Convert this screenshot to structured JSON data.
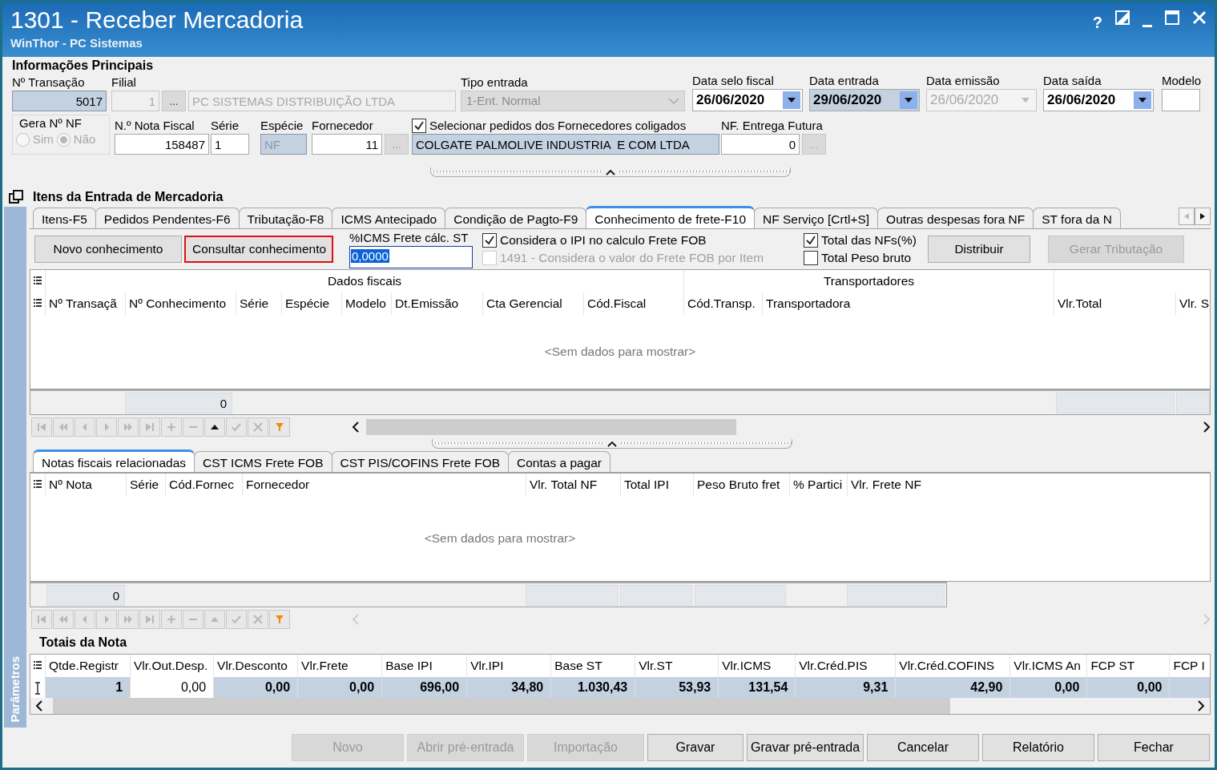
{
  "window": {
    "title": "1301 - Receber Mercadoria",
    "subtitle": "WinThor - PC Sistemas",
    "help": "?"
  },
  "header": {
    "title": "Informações Principais",
    "transacao": {
      "label": "Nº Transação",
      "value": "5017",
      "readonly": true
    },
    "filial": {
      "label": "Filial",
      "code": "1",
      "button": "...",
      "name": "PC SISTEMAS DISTRIBUIÇÃO LTDA",
      "disabled": true
    },
    "tipo_entrada": {
      "label": "Tipo entrada",
      "value": "1-Ent. Normal",
      "disabled": true
    },
    "dates": [
      {
        "label": "Data selo fiscal",
        "value": "26/06/2020",
        "readonly": false,
        "disabled": false
      },
      {
        "label": "Data entrada",
        "value": "29/06/2020",
        "readonly": true,
        "disabled": false
      },
      {
        "label": "Data emissão",
        "value": "26/06/2020",
        "readonly": false,
        "disabled": true
      },
      {
        "label": "Data saída",
        "value": "26/06/2020",
        "readonly": false,
        "disabled": false
      }
    ],
    "modelo": {
      "label": "Modelo"
    },
    "gera_nf": {
      "label": "Gera Nº NF",
      "disabled": true,
      "options": [
        {
          "label": "Sim",
          "selected": false
        },
        {
          "label": "Não",
          "selected": true
        }
      ]
    },
    "nota_fiscal": {
      "label": "N.º Nota Fiscal",
      "value": "158487"
    },
    "serie": {
      "label": "Série",
      "value": "1"
    },
    "especie": {
      "label": "Espécie",
      "value": "NF",
      "readonly": true
    },
    "fornecedor": {
      "label": "Fornecedor",
      "code": "11",
      "button": "...",
      "name": "COLGATE PALMOLIVE INDUSTRIA  E COM LTDA",
      "readonly": true
    },
    "coligados": {
      "label": "Selecionar pedidos dos Fornecedores coligados",
      "checked": true
    },
    "entrega_futura": {
      "label": "NF. Entrega Futura",
      "value": "0",
      "button": "..."
    }
  },
  "items": {
    "title": "Itens da Entrada de Mercadoria",
    "side_label": "Parâmetros",
    "tabs": [
      {
        "label": "Itens-F5",
        "selected": false
      },
      {
        "label": "Pedidos Pendentes-F6",
        "selected": false
      },
      {
        "label": "Tributação-F8",
        "selected": false
      },
      {
        "label": "ICMS Antecipado",
        "selected": false
      },
      {
        "label": "Condição de Pagto-F9",
        "selected": false
      },
      {
        "label": "Conhecimento de frete-F10",
        "selected": true
      },
      {
        "label": "NF Serviço [Crtl+S]",
        "selected": false
      },
      {
        "label": "Outras despesas fora NF",
        "selected": false
      },
      {
        "label": "ST fora da N",
        "selected": false
      }
    ],
    "toolbar": {
      "buttons": [
        {
          "label": "Novo conhecimento",
          "highlighted": false
        },
        {
          "label": "Consultar conhecimento",
          "highlighted": true
        }
      ],
      "icms": {
        "label": "%ICMS Frete cálc. ST",
        "value": "0,0000",
        "focused": true
      },
      "options": [
        {
          "label": "Considera o IPI no calculo Frete FOB",
          "checked": true,
          "disabled": false
        },
        {
          "label": "1491 - Considera o valor do Frete FOB por Item",
          "checked": false,
          "disabled": true
        }
      ],
      "totals_mode": [
        {
          "label": "Total das NFs(%)",
          "checked": true
        },
        {
          "label": "Total Peso bruto",
          "checked": false
        }
      ],
      "actions": [
        {
          "label": "Distribuir",
          "disabled": false
        },
        {
          "label": "Gerar Tributação",
          "disabled": true
        }
      ]
    },
    "grid": {
      "bands": [
        {
          "label": "Dados fiscais",
          "columns": [
            "Nº Transaçã",
            "Nº Conhecimento",
            "Série",
            "Espécie",
            "Modelo",
            "Dt.Emissão",
            "Cta Gerencial",
            "Cód.Fiscal"
          ]
        },
        {
          "label": "Transportadores",
          "columns": [
            "Cód.Transp.",
            "Transportadora"
          ]
        },
        {
          "columns": [
            "Vlr.Total",
            "Vlr. S"
          ]
        }
      ],
      "empty": "<Sem dados para mostrar>",
      "count": "0",
      "navigator": [
        {
          "kind": "first",
          "disabled": true
        },
        {
          "kind": "prev_page",
          "disabled": true
        },
        {
          "kind": "prev",
          "disabled": true
        },
        {
          "kind": "next",
          "disabled": true
        },
        {
          "kind": "next_page",
          "disabled": true
        },
        {
          "kind": "last",
          "disabled": true
        },
        {
          "kind": "add",
          "disabled": true
        },
        {
          "kind": "remove",
          "disabled": true
        },
        {
          "kind": "up",
          "disabled": false
        },
        {
          "kind": "confirm",
          "disabled": true
        },
        {
          "kind": "cancel",
          "disabled": true
        },
        {
          "kind": "filter",
          "disabled": false
        }
      ]
    },
    "subtabs": [
      {
        "label": "Notas fiscais relacionadas",
        "selected": true
      },
      {
        "label": "CST ICMS Frete FOB",
        "selected": false
      },
      {
        "label": "CST PIS/COFINS Frete FOB",
        "selected": false
      },
      {
        "label": "Contas a pagar",
        "selected": false
      }
    ],
    "subgrid": {
      "columns": [
        "Nº Nota",
        "Série",
        "Cód.Fornec",
        "Fornecedor",
        "Vlr. Total NF",
        "Total IPI",
        "Peso Bruto fret",
        "% Partici",
        "Vlr. Frete NF"
      ],
      "empty": "<Sem dados para mostrar>",
      "count": "0",
      "navigator": [
        {
          "kind": "first",
          "disabled": true
        },
        {
          "kind": "prev_page",
          "disabled": true
        },
        {
          "kind": "prev",
          "disabled": true
        },
        {
          "kind": "next",
          "disabled": true
        },
        {
          "kind": "next_page",
          "disabled": true
        },
        {
          "kind": "last",
          "disabled": true
        },
        {
          "kind": "add",
          "disabled": true
        },
        {
          "kind": "remove",
          "disabled": true
        },
        {
          "kind": "up",
          "disabled": true
        },
        {
          "kind": "confirm",
          "disabled": true
        },
        {
          "kind": "cancel",
          "disabled": true
        },
        {
          "kind": "filter",
          "disabled": false
        }
      ]
    },
    "totals": {
      "title": "Totais da Nota",
      "columns": [
        {
          "label": "Qtde.Registr",
          "value": "1",
          "editable": false
        },
        {
          "label": "Vlr.Out.Desp.",
          "value": "0,00",
          "editable": true
        },
        {
          "label": "Vlr.Desconto",
          "value": "0,00",
          "editable": false
        },
        {
          "label": "Vlr.Frete",
          "value": "0,00",
          "editable": false
        },
        {
          "label": "Base IPI",
          "value": "696,00",
          "editable": false
        },
        {
          "label": "Vlr.IPI",
          "value": "34,80",
          "editable": false
        },
        {
          "label": "Base ST",
          "value": "1.030,43",
          "editable": false
        },
        {
          "label": "Vlr.ST",
          "value": "53,93",
          "editable": false
        },
        {
          "label": "Vlr.ICMS",
          "value": "131,54",
          "editable": false
        },
        {
          "label": "Vlr.Créd.PIS",
          "value": "9,31",
          "editable": false
        },
        {
          "label": "Vlr.Créd.COFINS",
          "value": "42,90",
          "editable": false
        },
        {
          "label": "Vlr.ICMS An",
          "value": "0,00",
          "editable": false
        },
        {
          "label": "FCP ST",
          "value": "0,00",
          "editable": false
        },
        {
          "label": "FCP I",
          "editable": false
        }
      ]
    }
  },
  "buttons": [
    {
      "label": "Novo",
      "disabled": true
    },
    {
      "label": "Abrir pré-entrada",
      "disabled": true
    },
    {
      "label": "Importação",
      "disabled": true
    },
    {
      "label": "Gravar",
      "disabled": false
    },
    {
      "label": "Gravar pré-entrada",
      "disabled": false
    },
    {
      "label": "Cancelar",
      "disabled": false
    },
    {
      "label": "Relatório",
      "disabled": false
    },
    {
      "label": "Fechar",
      "disabled": false
    }
  ]
}
